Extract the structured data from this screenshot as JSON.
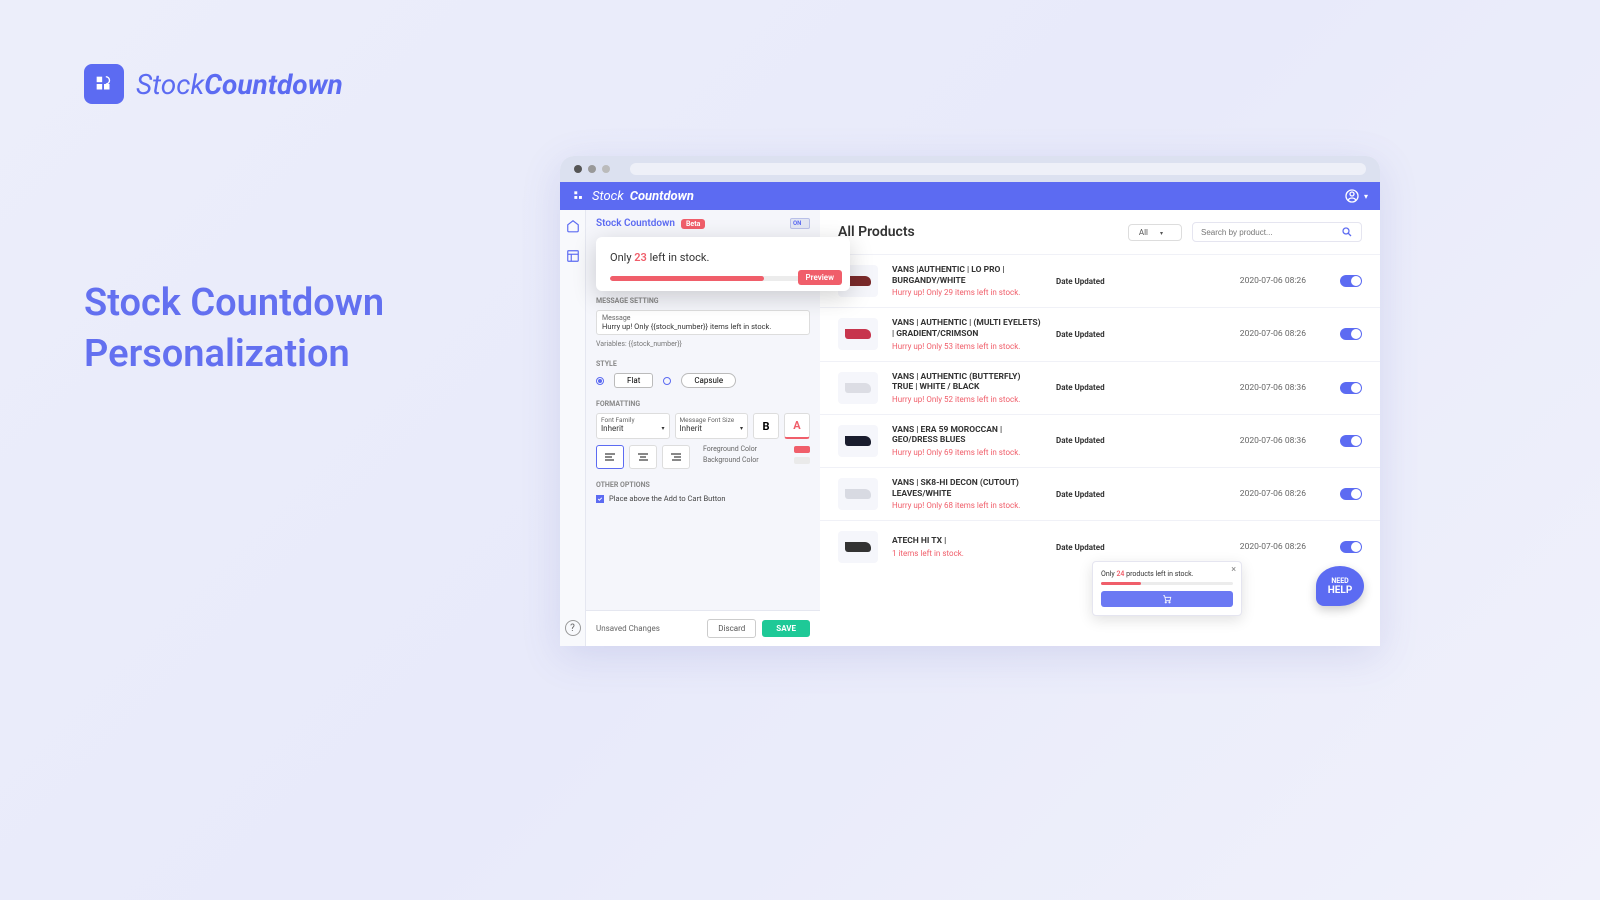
{
  "brand": {
    "name_light": "Stock",
    "name_bold": "Countdown"
  },
  "page_heading_1": "Stock Countdown",
  "page_heading_2": "Personalization",
  "config": {
    "title": "Stock Countdown",
    "beta": "Beta",
    "toggle": "ON",
    "preview": {
      "pre": "Only ",
      "num": "23",
      "post": " left in stock.",
      "button": "Preview"
    },
    "message_setting": "MESSAGE SETTING",
    "message_label": "Message",
    "message_value": "Hurry up! Only {{stock_number}} items left in stock.",
    "variables": "Variables: {{stock_number}}",
    "style_title": "STYLE",
    "style_flat": "Flat",
    "style_capsule": "Capsule",
    "formatting_title": "FORMATTING",
    "font_family_label": "Font Family",
    "font_family_value": "Inherit",
    "font_size_label": "Message Font Size",
    "font_size_value": "Inherit",
    "fg_color": "Foreground Color",
    "bg_color": "Background Color",
    "other_title": "OTHER OPTIONS",
    "other_check": "Place above the Add to Cart Button",
    "unsaved": "Unsaved Changes",
    "discard": "Discard",
    "save": "SAVE"
  },
  "main": {
    "title": "All Products",
    "filter": "All",
    "search_placeholder": "Search by product...",
    "date_label": "Date Updated",
    "products": [
      {
        "name": "VANS |AUTHENTIC | LO PRO | BURGANDY/WHITE",
        "msg": "Hurry up! Only 29 items left in stock.",
        "date": "2020-07-06 08:26",
        "shoe": "#7a2a2a"
      },
      {
        "name": "VANS | AUTHENTIC | (MULTI EYELETS) | GRADIENT/CRIMSON",
        "msg": "Hurry up! Only 53 items left in stock.",
        "date": "2020-07-06 08:26",
        "shoe": "#c7354d"
      },
      {
        "name": "VANS | AUTHENTIC (BUTTERFLY) TRUE | WHITE / BLACK",
        "msg": "Hurry up! Only 52 items left in stock.",
        "date": "2020-07-06 08:36",
        "shoe": "#dcdde4"
      },
      {
        "name": "VANS | ERA 59 MOROCCAN | GEO/DRESS BLUES",
        "msg": "Hurry up! Only 69 items left in stock.",
        "date": "2020-07-06 08:36",
        "shoe": "#1a1d2e"
      },
      {
        "name": "VANS | SK8-HI DECON (CUTOUT) LEAVES/WHITE",
        "msg": "Hurry up! Only 68 items left in stock.",
        "date": "2020-07-06 08:26",
        "shoe": "#d8dae2"
      },
      {
        "name": "ATECH HI TX |",
        "msg": "1 items left in stock.",
        "date": "2020-07-06 08:26",
        "shoe": "#333"
      }
    ]
  },
  "tooltip": {
    "pre": "Only ",
    "num": "24",
    "post": " products left in stock."
  },
  "help": {
    "line1": "NEED",
    "line2": "HELP"
  },
  "colors": {
    "fg": "#f05e6a",
    "bg": "#eaeaea"
  }
}
